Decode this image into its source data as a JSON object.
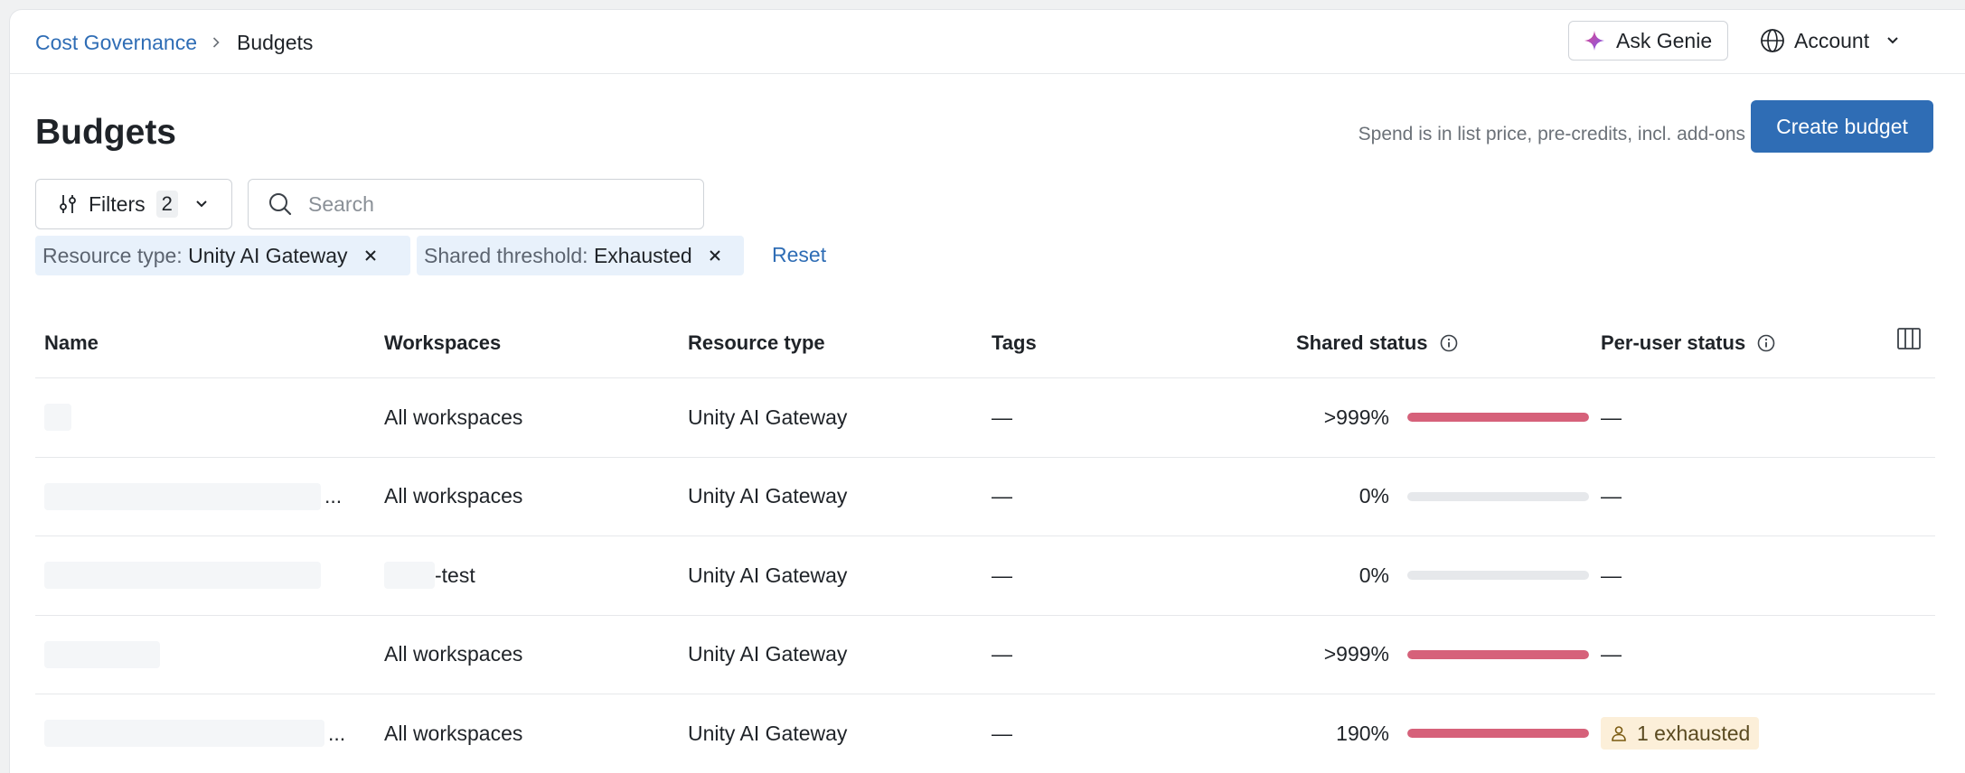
{
  "breadcrumb": {
    "parent": "Cost Governance",
    "current": "Budgets",
    "separator_icon": "chevron-right-icon"
  },
  "header_actions": {
    "ask_genie_label": "Ask Genie",
    "account_label": "Account"
  },
  "page": {
    "title": "Budgets",
    "spend_note": "Spend is in list price, pre-credits, incl. add-ons",
    "create_button_label": "Create budget"
  },
  "filters": {
    "button_label": "Filters",
    "count": "2",
    "search_placeholder": "Search",
    "search_value": "",
    "chips": [
      {
        "key": "Resource type:",
        "value": "Unity AI Gateway"
      },
      {
        "key": "Shared threshold:",
        "value": "Exhausted"
      }
    ],
    "reset_label": "Reset"
  },
  "table": {
    "headers": {
      "name": "Name",
      "workspaces": "Workspaces",
      "resource_type": "Resource type",
      "tags": "Tags",
      "shared_status": "Shared status",
      "per_user_status": "Per-user status"
    },
    "rows": [
      {
        "workspaces": "All workspaces",
        "resource_type": "Unity AI Gateway",
        "tags": "—",
        "shared_pct": ">999%",
        "shared_fill": 1.0,
        "per_user": "—",
        "name_ellipsis": "",
        "ws_redacted": false
      },
      {
        "workspaces": "All workspaces",
        "resource_type": "Unity AI Gateway",
        "tags": "—",
        "shared_pct": "0%",
        "shared_fill": 0.0,
        "per_user": "—",
        "name_ellipsis": "...",
        "ws_redacted": false
      },
      {
        "workspaces": "-test",
        "resource_type": "Unity AI Gateway",
        "tags": "—",
        "shared_pct": "0%",
        "shared_fill": 0.0,
        "per_user": "—",
        "name_ellipsis": "",
        "ws_redacted": true
      },
      {
        "workspaces": "All workspaces",
        "resource_type": "Unity AI Gateway",
        "tags": "—",
        "shared_pct": ">999%",
        "shared_fill": 1.0,
        "per_user": "—",
        "name_ellipsis": "",
        "ws_redacted": false
      },
      {
        "workspaces": "All workspaces",
        "resource_type": "Unity AI Gateway",
        "tags": "—",
        "shared_pct": "190%",
        "shared_fill": 1.0,
        "per_user": "1 exhausted",
        "name_ellipsis": "...",
        "ws_redacted": false
      }
    ]
  },
  "colors": {
    "accent": "#2f6db5",
    "bar_fill": "#d6617a",
    "bar_track": "#e6e8eb",
    "chip_bg": "#e8f1fb",
    "exhausted_bg": "#fcefd9"
  }
}
